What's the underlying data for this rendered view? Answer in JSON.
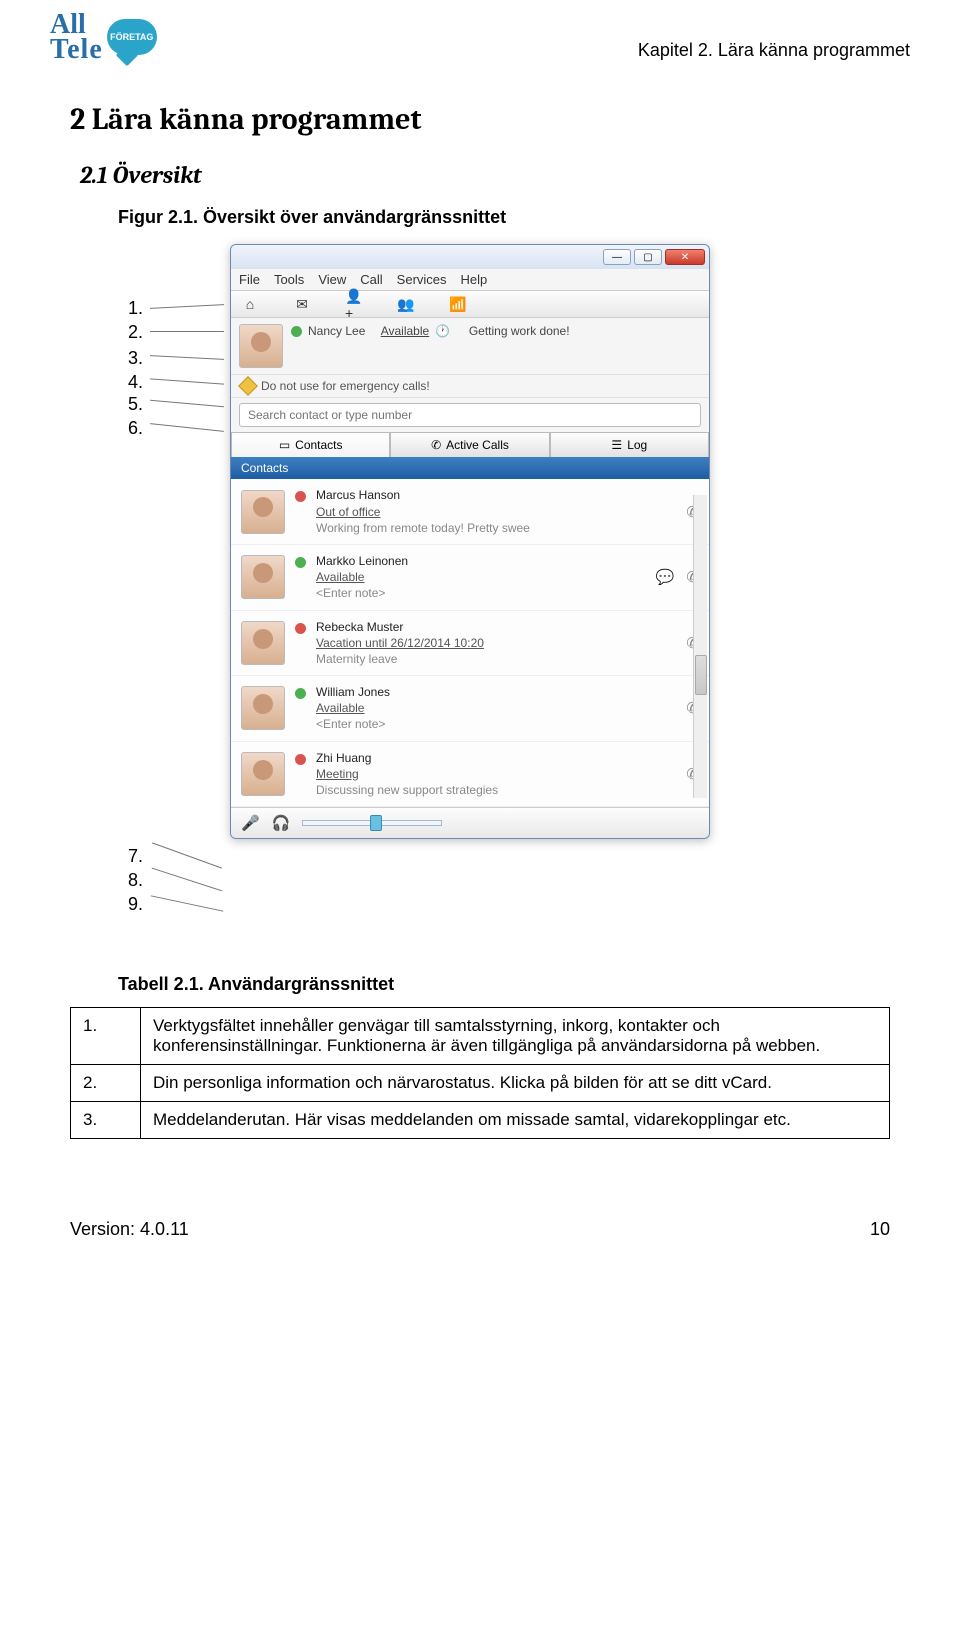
{
  "header": {
    "logo_line1": "All",
    "logo_line2": "Tele",
    "logo_bubble": "FÖRETAG",
    "chapter_ref": "Kapitel 2. Lära känna programmet"
  },
  "headings": {
    "h1": "2  Lära känna programmet",
    "h2": "2.1  Översikt",
    "figure_caption": "Figur 2.1. Översikt över användargränssnittet",
    "table_caption": "Tabell 2.1. Användargränssnittet"
  },
  "callouts": [
    "1.",
    "2.",
    "3.",
    "4.",
    "5.",
    "6.",
    "7.",
    "8.",
    "9."
  ],
  "window": {
    "menu": [
      "File",
      "Tools",
      "View",
      "Call",
      "Services",
      "Help"
    ],
    "toolbar_icons": [
      "home-icon",
      "mail-icon",
      "add-user-icon",
      "group-icon",
      "signal-icon"
    ],
    "profile": {
      "name": "Nancy Lee",
      "status": "Available",
      "status_glyph": "🕐",
      "note": "Getting work done!"
    },
    "message_warning": "Do not use for emergency calls!",
    "search_placeholder": "Search contact or type number",
    "tabs": [
      {
        "icon": "id-card-icon",
        "label": "Contacts"
      },
      {
        "icon": "phone-icon",
        "label": "Active Calls"
      },
      {
        "icon": "list-icon",
        "label": "Log"
      }
    ],
    "subheader": "Contacts",
    "contacts": [
      {
        "name": "Marcus Hanson",
        "status": "Out of office",
        "note": "Working from remote today! Pretty swee",
        "dot": "red",
        "icons": [
          "call-icon"
        ]
      },
      {
        "name": "Markko Leinonen",
        "status": "Available",
        "note": "<Enter note>",
        "dot": "green",
        "icons": [
          "chat-icon",
          "call-icon"
        ]
      },
      {
        "name": "Rebecka Muster",
        "status": "Vacation until 26/12/2014 10:20",
        "note": "Maternity leave",
        "dot": "red",
        "icons": [
          "call-icon"
        ]
      },
      {
        "name": "William Jones",
        "status": "Available",
        "note": "<Enter note>",
        "dot": "green",
        "icons": [
          "call-icon"
        ]
      },
      {
        "name": "Zhi Huang",
        "status": "Meeting",
        "note": "Discussing new support strategies",
        "dot": "red",
        "icons": [
          "call-icon"
        ]
      }
    ]
  },
  "table_rows": [
    {
      "num": "1.",
      "desc": "Verktygsfältet innehåller genvägar till samtalsstyrning, inkorg, kontakter och konferensinställningar. Funktionerna är även tillgängliga på användarsidorna på webben."
    },
    {
      "num": "2.",
      "desc": "Din personliga information och närvarostatus. Klicka på bilden för att se ditt vCard."
    },
    {
      "num": "3.",
      "desc": "Meddelanderutan. Här visas meddelanden om missade samtal, vidarekopplingar etc."
    }
  ],
  "footer": {
    "version_label": "Version: 4.0.11",
    "page_number": "10"
  },
  "icon_glyphs": {
    "home-icon": "⌂",
    "mail-icon": "✉",
    "add-user-icon": "👤+",
    "group-icon": "👥",
    "signal-icon": "📶",
    "id-card-icon": "▭",
    "phone-icon": "✆",
    "list-icon": "☰",
    "call-icon": "✆",
    "chat-icon": "💬"
  }
}
